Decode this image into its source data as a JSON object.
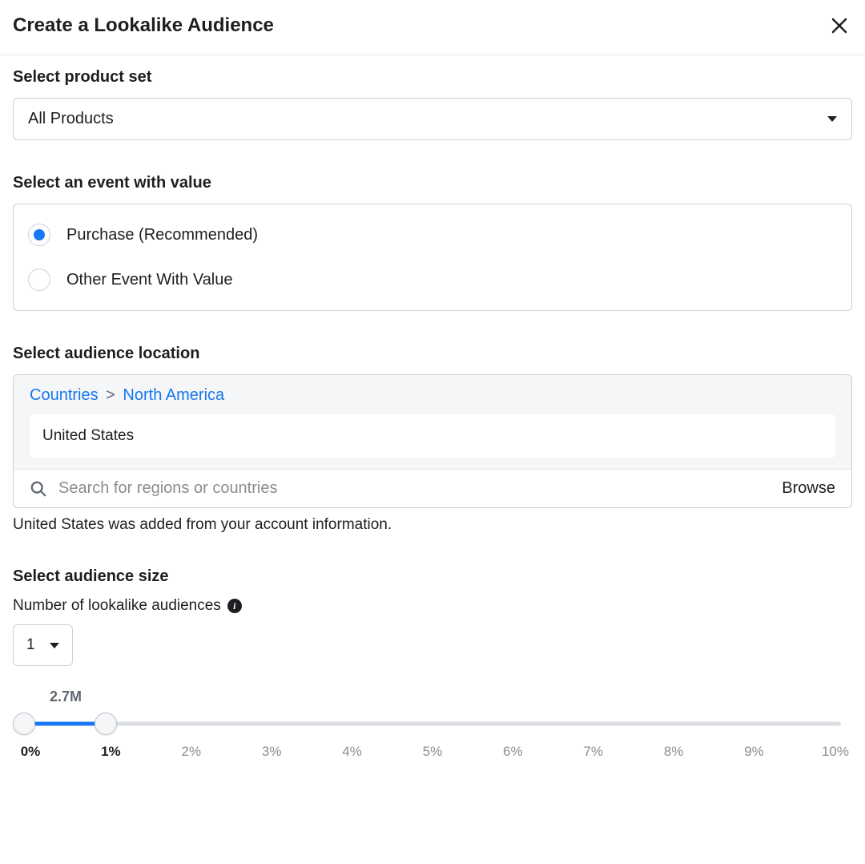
{
  "header": {
    "title": "Create a Lookalike Audience"
  },
  "product_set": {
    "label": "Select product set",
    "selected": "All Products"
  },
  "event": {
    "label": "Select an event with value",
    "options": [
      {
        "label": "Purchase (Recommended)",
        "checked": true
      },
      {
        "label": "Other Event With Value",
        "checked": false
      }
    ]
  },
  "location": {
    "label": "Select audience location",
    "breadcrumb": {
      "root": "Countries",
      "region": "North America",
      "sep": ">"
    },
    "selected": "United States",
    "search_placeholder": "Search for regions or countries",
    "browse": "Browse",
    "helper": "United States was added from your account information."
  },
  "size": {
    "label": "Select audience size",
    "count_label": "Number of lookalike audiences",
    "count_value": "1",
    "slider_value_label": "2.7M",
    "slider_low_pct": 0,
    "slider_high_pct": 10,
    "ticks": [
      "0%",
      "1%",
      "2%",
      "3%",
      "4%",
      "5%",
      "6%",
      "7%",
      "8%",
      "9%",
      "10%"
    ],
    "active_ticks": [
      0,
      1
    ]
  }
}
